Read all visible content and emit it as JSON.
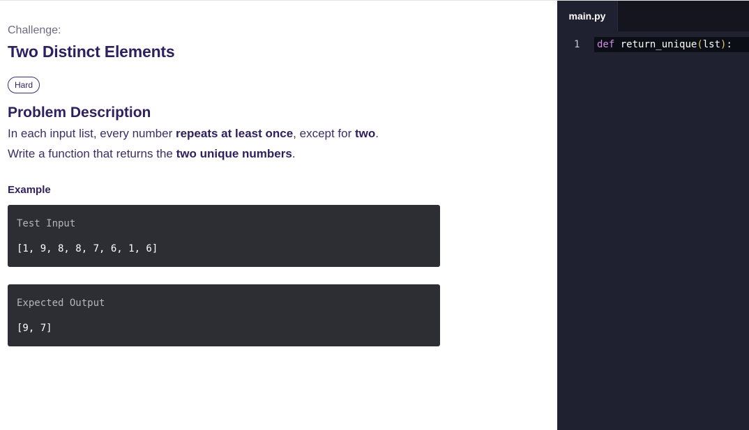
{
  "challenge": {
    "label": "Challenge:",
    "title": "Two Distinct Elements",
    "difficulty": "Hard"
  },
  "problem": {
    "heading": "Problem Description",
    "line1": {
      "a": "In each input list, every number ",
      "b": "repeats at least once",
      "c": ", except for ",
      "d": "two",
      "e": "."
    },
    "line2": {
      "a": "Write a function that returns the ",
      "b": "two unique numbers",
      "c": "."
    }
  },
  "example": {
    "heading": "Example",
    "input_label": "Test Input",
    "input_value": "[1, 9, 8, 8, 7, 6, 1, 6]",
    "output_label": "Expected Output",
    "output_value": "[9, 7]"
  },
  "editor": {
    "tab": "main.py",
    "lines": [
      {
        "number": "1",
        "keyword": "def",
        "name": "return_unique",
        "open": "(",
        "arg": "lst",
        "close": ")",
        "colon": ":"
      }
    ]
  },
  "colors": {
    "title": "#2e1f5e",
    "code_bg": "#2d2e33",
    "editor_bg": "#1f2130",
    "keyword": "#d08be3",
    "paren": "#e5c76b"
  }
}
